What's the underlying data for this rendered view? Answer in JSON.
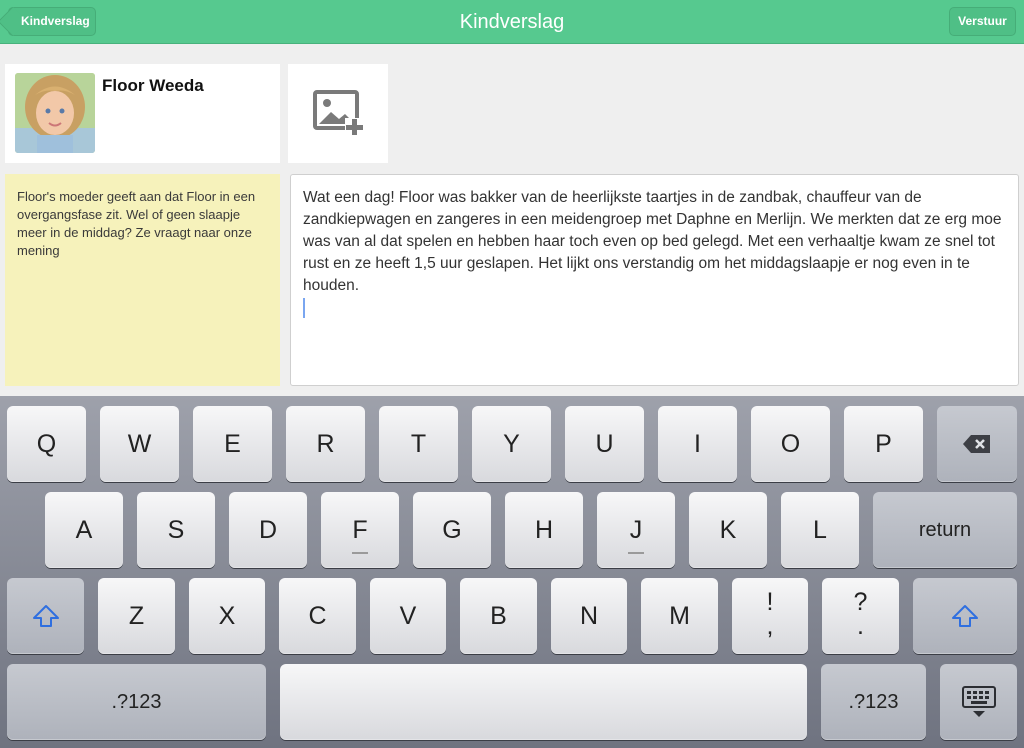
{
  "navbar": {
    "title": "Kindverslag",
    "back_label": "Kindverslag",
    "send_label": "Verstuur"
  },
  "child": {
    "name": "Floor Weeda"
  },
  "note": {
    "text": "Floor's moeder geeft aan dat Floor in een overgangsfase zit. Wel of geen slaapje meer in de middag? Ze vraagt naar onze mening"
  },
  "report": {
    "text": "Wat een dag! Floor was bakker van de heerlijkste taartjes in de zandbak, chauffeur van de zandkiepwagen en zangeres in een meidengroep met Daphne en Merlijn. We merkten dat ze erg moe was van al dat spelen en hebben haar toch even op bed gelegd. Met een verhaaltje kwam ze snel tot rust en ze heeft 1,5 uur geslapen. Het lijkt ons verstandig om het middagslaapje er nog even in te houden."
  },
  "keyboard": {
    "row1": [
      "Q",
      "W",
      "E",
      "R",
      "T",
      "Y",
      "U",
      "I",
      "O",
      "P"
    ],
    "row2": [
      "A",
      "S",
      "D",
      "F",
      "G",
      "H",
      "J",
      "K",
      "L"
    ],
    "row3": [
      "Z",
      "X",
      "C",
      "V",
      "B",
      "N",
      "M"
    ],
    "punct1": {
      "top": "!",
      "bottom": ","
    },
    "punct2": {
      "top": "?",
      "bottom": "."
    },
    "return_label": "return",
    "numbers_label": ".?123",
    "icons": {
      "backspace": "backspace-icon",
      "shift": "shift-icon",
      "hide": "keyboard-hide-icon",
      "add_photo": "add-photo-icon"
    },
    "accent": "#2f6fe0"
  }
}
